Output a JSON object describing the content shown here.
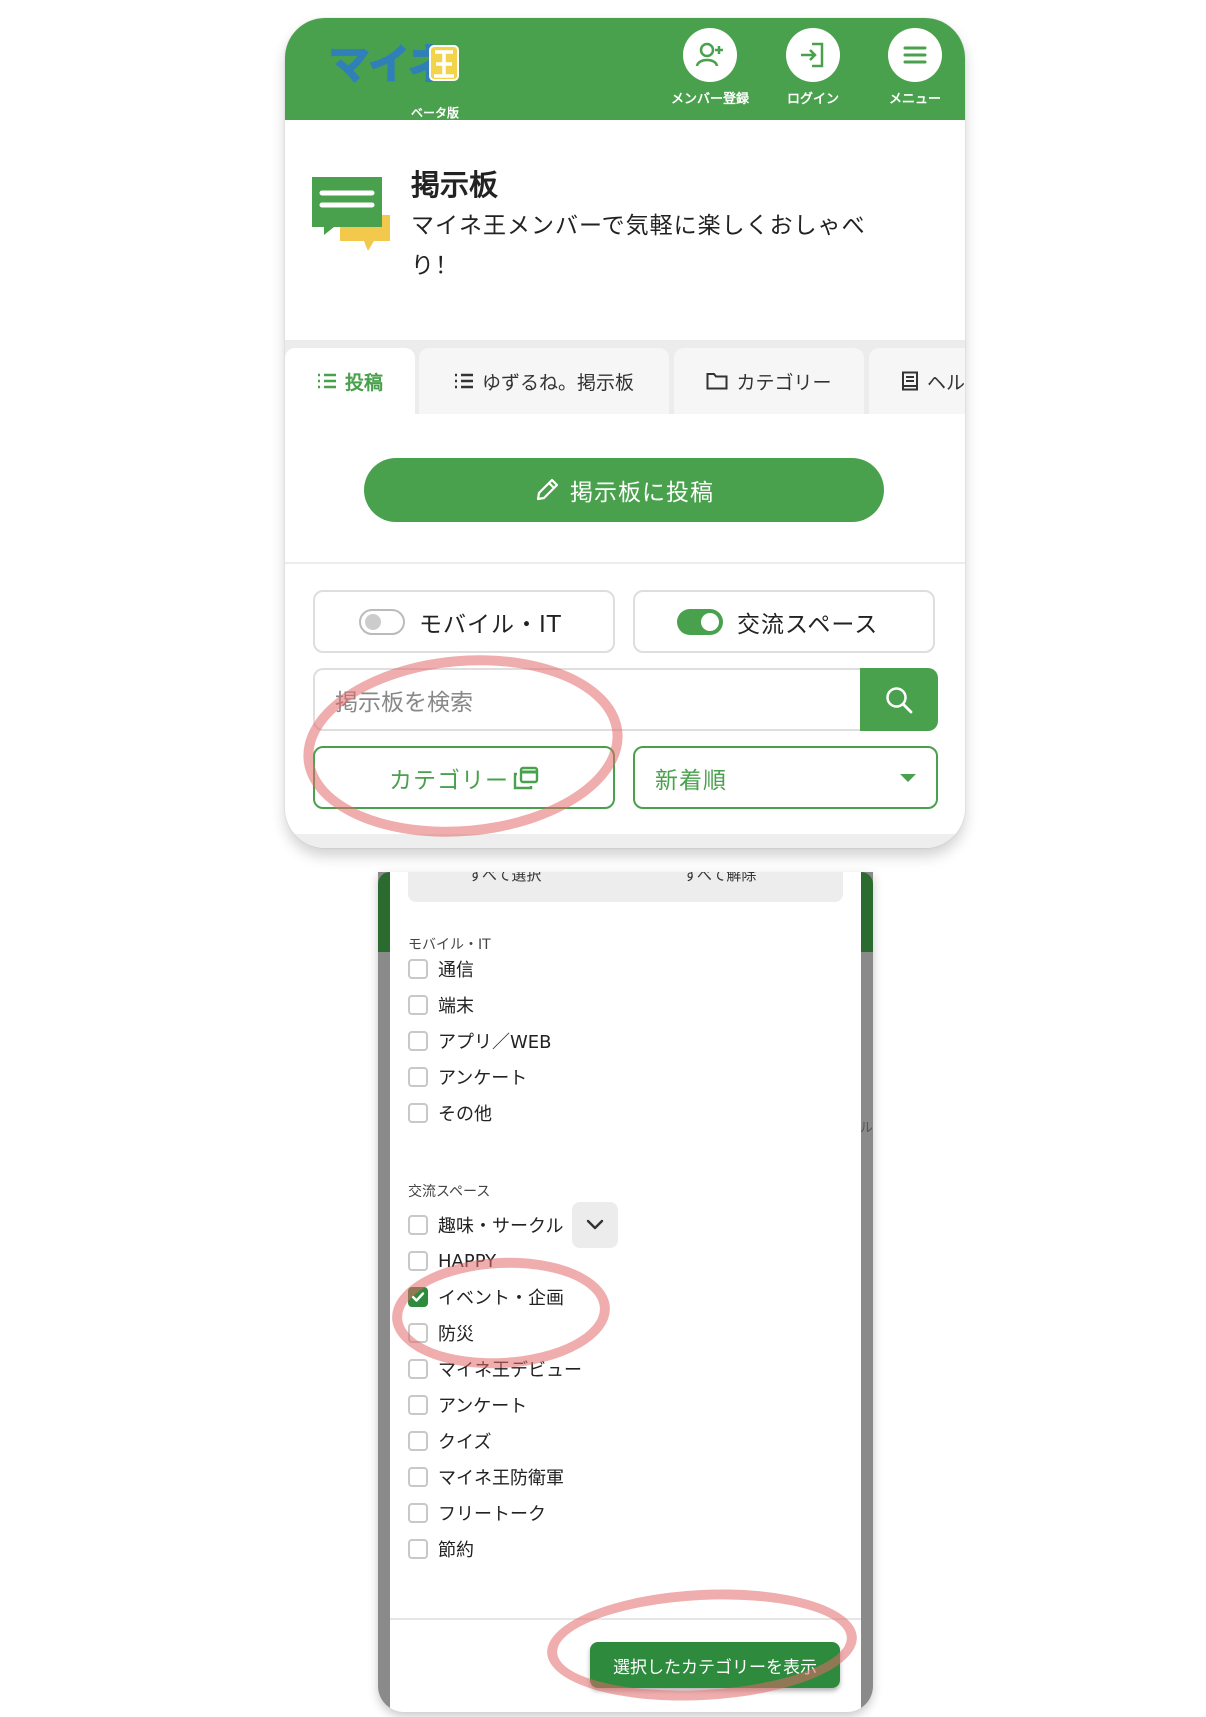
{
  "colors": {
    "brand_green": "#4aa14d",
    "checkbox_green": "#2e8b3d",
    "annotation_red": "#e16969"
  },
  "header": {
    "logo_text": "マイネ王",
    "logo_sub": "ベータ版",
    "buttons": [
      {
        "label": "メンバー登録",
        "icon": "person-add-icon"
      },
      {
        "label": "ログイン",
        "icon": "login-icon"
      },
      {
        "label": "メニュー",
        "icon": "hamburger-menu-icon"
      }
    ]
  },
  "intro": {
    "icon": "chat-bubbles-icon",
    "title": "掲示板",
    "description": "マイネ王メンバーで気軽に楽しくおしゃべり！"
  },
  "tabs": [
    {
      "label": "投稿",
      "icon": "list-icon",
      "active": true
    },
    {
      "label": "ゆずるね。掲示板",
      "icon": "list-icon",
      "active": false
    },
    {
      "label": "カテゴリー",
      "icon": "folder-icon",
      "active": false
    },
    {
      "label": "ヘル",
      "icon": "book-icon",
      "active": false
    }
  ],
  "post_button": {
    "label": "掲示板に投稿",
    "icon": "pencil-icon"
  },
  "filters": {
    "toggles": [
      {
        "label": "モバイル・IT",
        "on": false
      },
      {
        "label": "交流スペース",
        "on": true
      }
    ],
    "search_placeholder": "掲示板を検索",
    "category_button": "カテゴリー",
    "sort_value": "新着順"
  },
  "category_panel": {
    "select_all": "すべて選択",
    "deselect_all": "すべて解除",
    "side_fragment": "ル",
    "groups": [
      {
        "name": "モバイル・IT",
        "items": [
          {
            "label": "通信",
            "checked": false
          },
          {
            "label": "端末",
            "checked": false
          },
          {
            "label": "アプリ／WEB",
            "checked": false
          },
          {
            "label": "アンケート",
            "checked": false
          },
          {
            "label": "その他",
            "checked": false
          }
        ]
      },
      {
        "name": "交流スペース",
        "items": [
          {
            "label": "趣味・サークル",
            "checked": false
          },
          {
            "label": "HAPPY",
            "checked": false
          },
          {
            "label": "イベント・企画",
            "checked": true
          },
          {
            "label": "防災",
            "checked": false
          },
          {
            "label": "マイネ王デビュー",
            "checked": false
          },
          {
            "label": "アンケート",
            "checked": false
          },
          {
            "label": "クイズ",
            "checked": false
          },
          {
            "label": "マイネ王防衛軍",
            "checked": false
          },
          {
            "label": "フリートーク",
            "checked": false
          },
          {
            "label": "節約",
            "checked": false
          }
        ]
      }
    ],
    "show_button": "選択したカテゴリーを表示"
  }
}
